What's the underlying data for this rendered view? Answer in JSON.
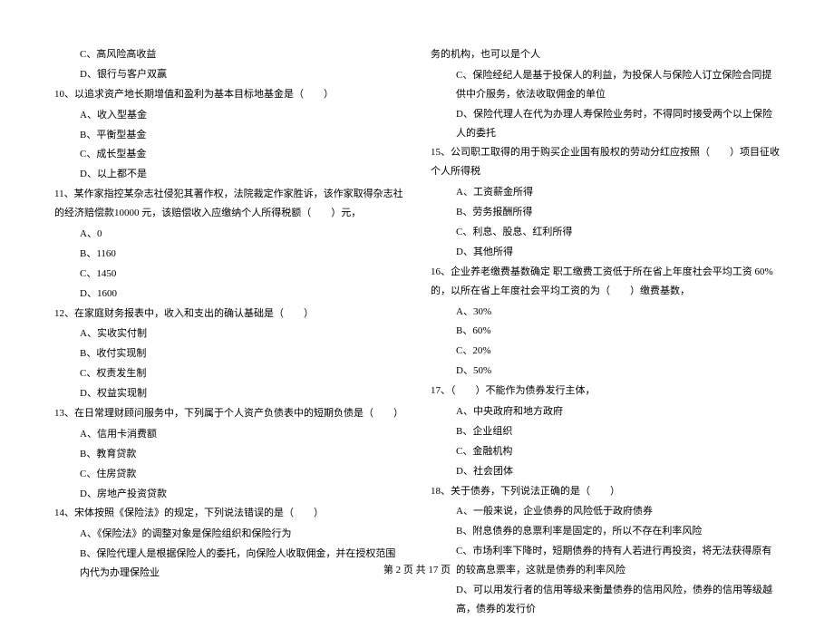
{
  "left": {
    "q9c": "C、高风险高收益",
    "q9d": "D、银行与客户双赢",
    "q10": "10、以追求资产地长期增值和盈利为基本目标地基金是（　　）",
    "q10a": "A、收入型基金",
    "q10b": "B、平衡型基金",
    "q10c": "C、成长型基金",
    "q10d": "D、以上都不是",
    "q11": "11、某作家指控某杂志社侵犯其著作权，法院裁定作家胜诉，该作家取得杂志社的经济赔偿款10000 元，该赔偿收入应缴纳个人所得税额（　　）元，",
    "q11a": "A、0",
    "q11b": "B、1160",
    "q11c": "C、1450",
    "q11d": "D、1600",
    "q12": "12、在家庭财务报表中，收入和支出的确认基础是（　　）",
    "q12a": "A、实收实付制",
    "q12b": "B、收付实现制",
    "q12c": "C、权责发生制",
    "q12d": "D、权益实现制",
    "q13": "13、在日常理财顾问服务中，下列属于个人资产负债表中的短期负债是（　　）",
    "q13a": "A、信用卡消费额",
    "q13b": "B、教育贷款",
    "q13c": "C、住房贷款",
    "q13d": "D、房地产投资贷款",
    "q14": "14、宋体按照《保险法》的规定，下列说法错误的是（　　）",
    "q14a": "A、《保险法》的调整对象是保险组织和保险行为",
    "q14b": "B、保险代理人是根据保险人的委托，向保险人收取佣金，并在授权范围内代为办理保险业"
  },
  "right": {
    "q14b2": "务的机构，也可以是个人",
    "q14c": "C、保险经纪人是基于投保人的利益，为投保人与保险人订立保险合同提供中介服务，依法收取佣金的单位",
    "q14d": "D、保险代理人在代为办理人寿保险业务时，不得同时接受两个以上保险人的委托",
    "q15": "15、公司职工取得的用于购买企业国有股权的劳动分红应按照（　　）项目征收个人所得税",
    "q15a": "A、工资薪金所得",
    "q15b": "B、劳务报酬所得",
    "q15c": "C、利息、股息、红利所得",
    "q15d": "D、其他所得",
    "q16": "16、企业养老缴费基数确定 职工缴费工资低于所在省上年度社会平均工资 60%的，以所在省上年度社会平均工资的为（　　）缴费基数，",
    "q16a": "A、30%",
    "q16b": "B、60%",
    "q16c": "C、20%",
    "q16d": "D、50%",
    "q17": "17、（　　）不能作为债券发行主体，",
    "q17a": "A、中央政府和地方政府",
    "q17b": "B、企业组织",
    "q17c": "C、金融机构",
    "q17d": "D、社会团体",
    "q18": "18、关于债券，下列说法正确的是（　　）",
    "q18a": "A、一般来说，企业债券的风险低于政府债券",
    "q18b": "B、附息债券的息票利率是固定的，所以不存在利率风险",
    "q18c": "C、市场利率下降时，短期债券的持有人若进行再投资，将无法获得原有的较高息票率，这就是债券的利率风险",
    "q18d": "D、可以用发行者的信用等级来衡量债券的信用风险，债券的信用等级越高，债券的发行价"
  },
  "footer": "第 2 页 共 17 页"
}
